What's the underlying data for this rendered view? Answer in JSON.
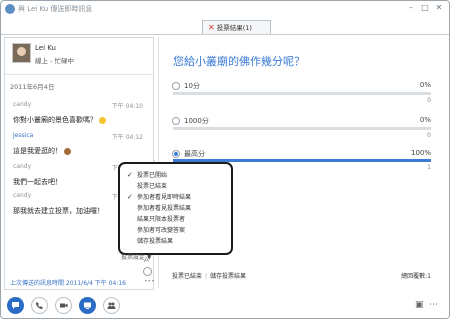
{
  "window": {
    "title": "與 Lei Ku 傳送即時訊息",
    "controls": [
      "minimize-icon",
      "maximize-icon",
      "close-icon"
    ]
  },
  "tab": {
    "label": "投票結果(1)",
    "close_icon": "close-icon"
  },
  "contact": {
    "name": "Lei Ku",
    "status": "線上 - 忙碌中"
  },
  "chat": {
    "date": "2011年6月4日",
    "messages": [
      {
        "sender": "candy",
        "time": "下午 04:10",
        "text": "你對小叢廟的景色喜歡嗎？"
      },
      {
        "sender": "Jessica",
        "time": "下午 04:12",
        "text": "這是我愛逛的！"
      },
      {
        "sender": "candy",
        "time": "下午 04:13",
        "text": "我們一起去吧！"
      },
      {
        "sender": "candy",
        "time": "下午 04:15",
        "text": "那我就去建立投票，加油囉！"
      }
    ],
    "footer_link": "上次傳送的訊息時間 2011/6/4 下午 04:16",
    "side_icons": [
      "font-icon",
      "emoticon-icon",
      "more-icon"
    ]
  },
  "poll": {
    "question": "您給小叢廟的佛作幾分呢？",
    "options": [
      {
        "label": "10分",
        "percent": 0,
        "percent_label": "0%",
        "count": "0",
        "selected": false
      },
      {
        "label": "1000分",
        "percent": 0,
        "percent_label": "0%",
        "count": "0",
        "selected": false
      },
      {
        "label": "最高分",
        "percent": 100,
        "percent_label": "100%",
        "count": "1",
        "selected": true
      }
    ],
    "menu": {
      "items": [
        {
          "label": "投票已開始",
          "checked": true
        },
        {
          "label": "投票已結束",
          "checked": false
        },
        {
          "label": "參加者看見即時結果",
          "checked": true
        },
        {
          "label": "參加者看見投票結果",
          "checked": false
        },
        {
          "label": "結果只限本投票者",
          "checked": false
        },
        {
          "label": "參加者可改變答案",
          "checked": false
        },
        {
          "label": "儲存投票結果",
          "checked": false
        }
      ],
      "button_label": "投票設定 ▼"
    },
    "footer": {
      "link1": "投票已結束",
      "link2": "儲存投票結果",
      "total": "總回覆數:1"
    }
  },
  "bottom_bar": {
    "buttons": [
      "chat-icon",
      "phone-icon",
      "video-icon",
      "share-icon",
      "people-icon"
    ],
    "right_icons": [
      "layout-icon",
      "settings-icon"
    ]
  },
  "colors": {
    "accent": "#3a7bd5",
    "bar_bg": "#d9dee2",
    "button_blue": "#2b6cc4"
  }
}
